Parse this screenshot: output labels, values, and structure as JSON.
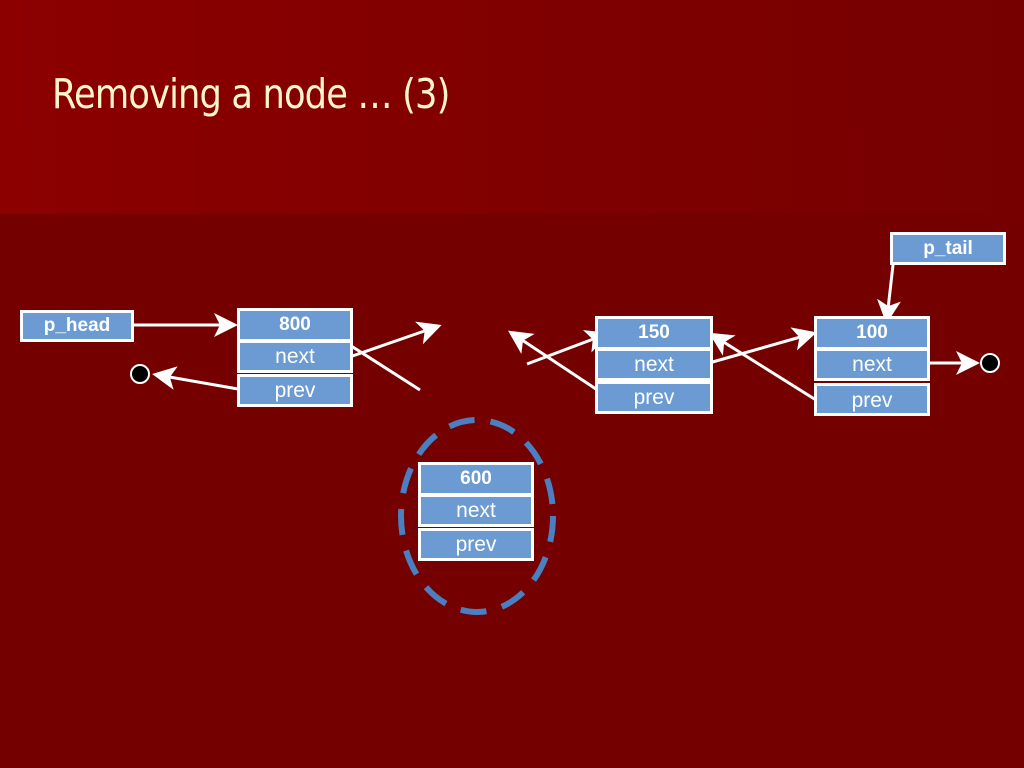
{
  "slide": {
    "title": "Removing a node … (3)"
  },
  "colors": {
    "background": "#740000",
    "title": "#fff5cc",
    "node_fill": "#6b9bd2",
    "node_border": "#ffffff",
    "removed_highlight": "#4a7fc1"
  },
  "pointers": {
    "head": "p_head",
    "tail": "p_tail"
  },
  "nodes": [
    {
      "value": "800",
      "next_label": "next",
      "prev_label": "prev"
    },
    {
      "value": "150",
      "next_label": "next",
      "prev_label": "prev"
    },
    {
      "value": "100",
      "next_label": "next",
      "prev_label": "prev"
    }
  ],
  "removed_node": {
    "value": "600",
    "next_label": "next",
    "prev_label": "prev"
  },
  "null_markers": [
    "null-left",
    "null-right"
  ]
}
